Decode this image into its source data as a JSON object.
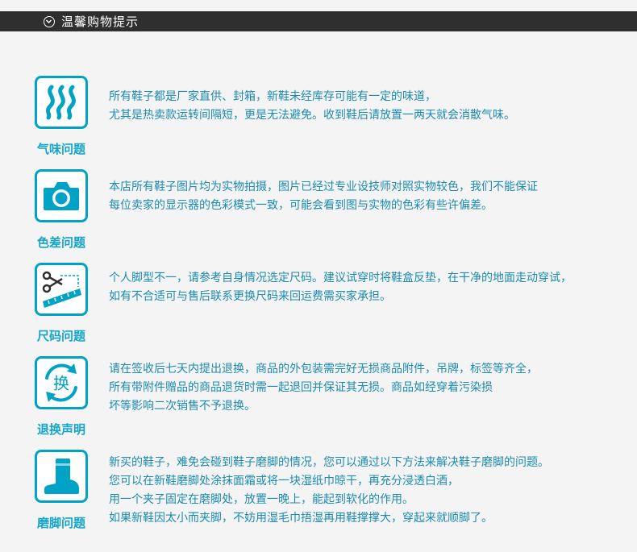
{
  "header": {
    "title": "温馨购物提示"
  },
  "items": [
    {
      "label": "气味问题",
      "icon": "steam-icon",
      "lines": [
        "所有鞋子都是厂家直供、封箱，新鞋未经库存可能有一定的味道，",
        "尤其是热卖款运转间隔短，更是无法避免。收到鞋后请放置一两天就会消散气味。"
      ]
    },
    {
      "label": "色差问题",
      "icon": "camera-icon",
      "lines": [
        "本店所有鞋子图片均为实物拍摄，图片已经过专业设技师对照实物较色，我们不能保证",
        "每位卖家的显示器的色彩模式一致，可能会看到图与实物的色彩有些许偏差。"
      ]
    },
    {
      "label": "尺码问题",
      "icon": "scissors-ruler-icon",
      "lines": [
        "个人脚型不一，请参考自身情况选定尺码。建议试穿时将鞋盒反垫，在干净的地面走动穿试，",
        "如有不合适可与售后联系更换尺码来回运费需买家承担。"
      ]
    },
    {
      "label": "退换声明",
      "icon": "exchange-icon",
      "icon_text": "换",
      "lines": [
        "请在签收后七天内提出退换，商品的外包装需完好无损商品附件，吊牌，标签等齐全，",
        "所有带附件赠品的商品退货时需一起退回并保证其无损。商品如经穿着污染损",
        "坏等影响二次销售不予退换。"
      ]
    },
    {
      "label": "磨脚问题",
      "icon": "boot-icon",
      "lines": [
        "新买的鞋子，难免会碰到鞋子磨脚的情况，您可以通过以下方法来解决鞋子磨脚的问题。",
        "您可以在新鞋磨脚处涂抹面霜或将一块湿纸巾晾干，再充分浸透白酒，",
        "用一个夹子固定在磨脚处，放置一晚上，能起到软化的作用。",
        "如果新鞋因太小而夹脚，不妨用湿毛巾捂湿再用鞋撑撑大，穿起来就顺脚了。"
      ]
    }
  ],
  "colors": {
    "accent": "#00a2c6",
    "text": "#1d8ab0",
    "header_bg": "#2f2f2f"
  }
}
